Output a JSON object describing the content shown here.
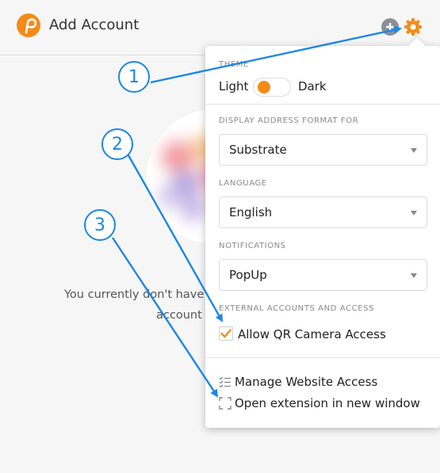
{
  "header": {
    "title": "Add Account"
  },
  "empty_state": {
    "line1": "You currently don't have",
    "line2": "account t"
  },
  "settings": {
    "theme_label": "THEME",
    "theme_light": "Light",
    "theme_dark": "Dark",
    "theme_value": "light",
    "address_format_label": "DISPLAY ADDRESS FORMAT FOR",
    "address_format_value": "Substrate",
    "language_label": "LANGUAGE",
    "language_value": "English",
    "notifications_label": "NOTIFICATIONS",
    "notifications_value": "PopUp",
    "external_label": "EXTERNAL ACCOUNTS AND ACCESS",
    "qr_camera_label": "Allow QR Camera Access",
    "qr_camera_checked": true,
    "manage_access_label": "Manage Website Access",
    "open_window_label": "Open extension in new window"
  },
  "callouts": [
    "1",
    "2",
    "3"
  ],
  "colors": {
    "accent": "#f58b17",
    "annotation": "#1b87e6"
  },
  "icons": [
    "polkadot-logo-icon",
    "add-circle-icon",
    "gear-icon",
    "chevron-down-icon",
    "checkmark-icon",
    "list-check-icon",
    "expand-window-icon"
  ]
}
